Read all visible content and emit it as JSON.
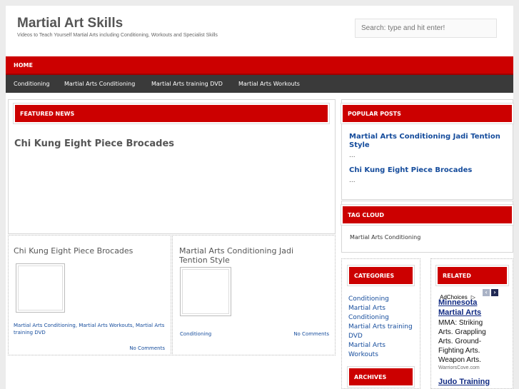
{
  "site": {
    "title": "Martial Art Skills",
    "description": "Videos to Teach Yourself Martial Arts including Conditioning, Workouts and Specialist Skills"
  },
  "search": {
    "placeholder": "Search: type and hit enter!"
  },
  "nav_primary": {
    "home": "HOME"
  },
  "nav_secondary": [
    "Conditioning",
    "Martial Arts Conditioning",
    "Martial Arts training DVD",
    "Martial Arts Workouts"
  ],
  "featured": {
    "heading": "FEATURED NEWS",
    "title": "Chi Kung Eight Piece Brocades"
  },
  "posts": [
    {
      "title": "Chi Kung Eight Piece Brocades",
      "categories": "Martial Arts Conditioning, Martial Arts Workouts, Martial Arts training DVD",
      "comments": "No Comments"
    },
    {
      "title": "Martial Arts Conditioning Jadi Tention Style",
      "categories": "Conditioning",
      "comments": "No Comments"
    }
  ],
  "popular": {
    "heading": "POPULAR POSTS",
    "items": [
      {
        "title": "Martial Arts Conditioning Jadi Tention Style",
        "excerpt": "..."
      },
      {
        "title": "Chi Kung Eight Piece Brocades",
        "excerpt": "..."
      }
    ]
  },
  "tag_cloud": {
    "heading": "TAG CLOUD",
    "tags": [
      "Martial Arts Conditioning"
    ]
  },
  "categories": {
    "heading": "CATEGORIES",
    "items": [
      "Conditioning",
      "Martial Arts Conditioning",
      "Martial Arts training DVD",
      "Martial Arts Workouts"
    ]
  },
  "archives": {
    "heading": "ARCHIVES"
  },
  "related": {
    "heading": "RELATED",
    "ad_choices": "AdChoices",
    "ads": [
      {
        "title": "Minnesota Martial Arts",
        "body": "MMA: Striking Arts. Grappling Arts. Ground-Fighting Arts. Weapon Arts.",
        "url": "WarriorsCove.com"
      },
      {
        "title": "Judo Training"
      }
    ]
  },
  "colors": {
    "accent": "#cc0000",
    "nav_dark": "#3a3a3a",
    "link": "#154c9c"
  }
}
